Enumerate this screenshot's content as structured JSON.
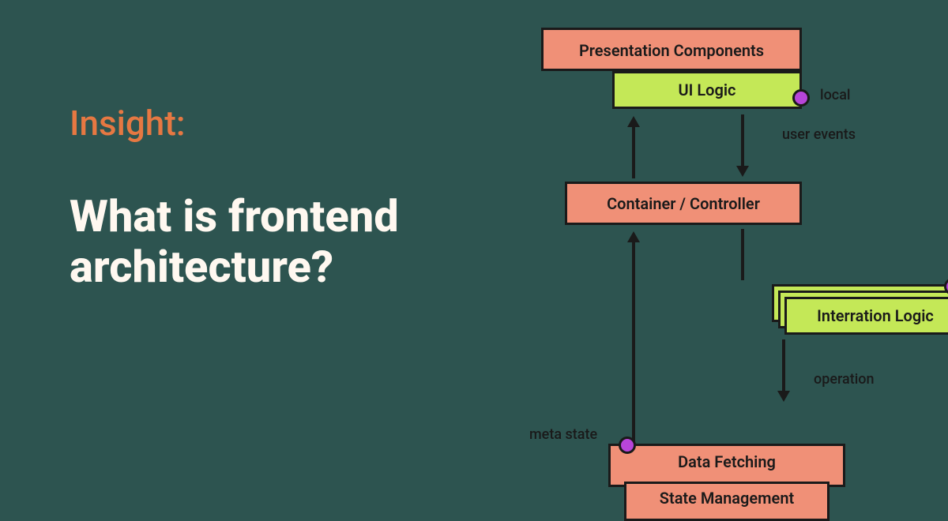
{
  "left": {
    "insight_label": "Insight:",
    "main_title": "What is frontend architecture?"
  },
  "diagram": {
    "presentation": "Presentation Components",
    "ui_logic": "UI Logic",
    "local": "local",
    "user_events": "user events",
    "container": "Container / Controller",
    "interration_logic": "Interration Logic",
    "operation": "operation",
    "meta_state": "meta state",
    "data_fetching": "Data Fetching",
    "state_management": "State Management"
  },
  "colors": {
    "bg": "#2d5450",
    "accent": "#e67842",
    "box_orange": "#f09077",
    "box_green": "#c4e857",
    "dot": "#b845d9"
  }
}
